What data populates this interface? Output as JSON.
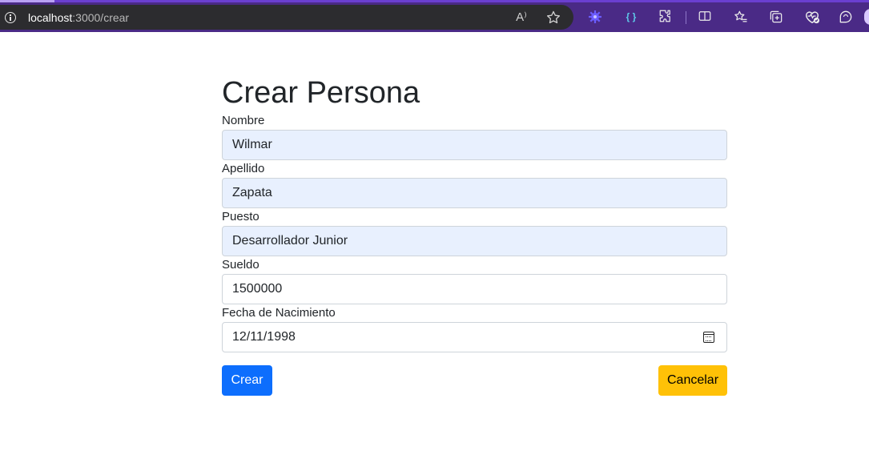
{
  "browser": {
    "url_host": "localhost",
    "url_path": ":3000/crear",
    "icons": [
      "info-icon",
      "read-aloud-icon",
      "favorite-star-icon",
      "extension-gear-icon",
      "json-extension-icon",
      "extensions-puzzle-icon",
      "split-screen-icon",
      "favorites-icon",
      "collections-icon",
      "browser-essentials-icon",
      "copilot-icon"
    ],
    "read_aloud_glyph": "A⁾",
    "json_ext_glyph": "{ }"
  },
  "form": {
    "title": "Crear Persona",
    "fields": [
      {
        "label": "Nombre",
        "value": "Wilmar"
      },
      {
        "label": "Apellido",
        "value": "Zapata"
      },
      {
        "label": "Puesto",
        "value": "Desarrollador Junior"
      },
      {
        "label": "Sueldo",
        "value": "1500000"
      },
      {
        "label": "Fecha de Nacimiento",
        "value": "12/11/1998"
      }
    ],
    "submit_label": "Crear",
    "cancel_label": "Cancelar"
  },
  "colors": {
    "primary": "#0d6efd",
    "warning": "#ffc107",
    "autofill": "#e8f0fe",
    "chrome": "#4a2a86"
  }
}
